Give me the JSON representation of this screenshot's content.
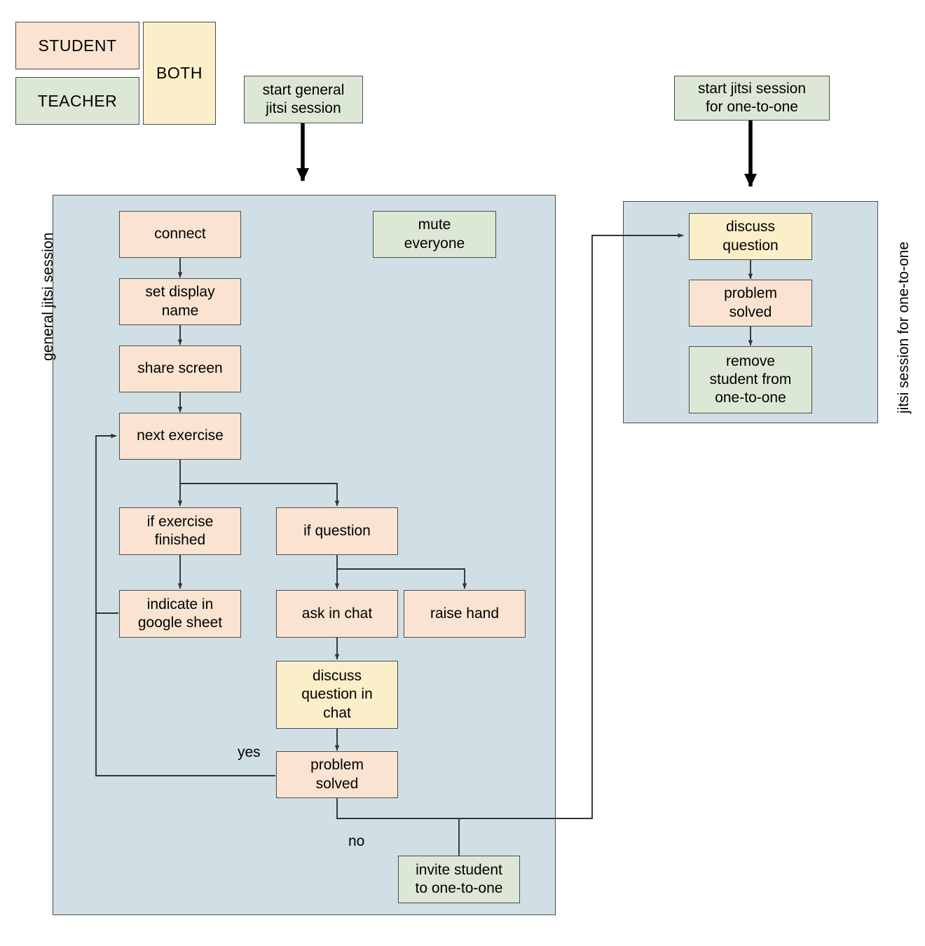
{
  "legend": {
    "items": [
      {
        "label": "STUDENT",
        "role": "student",
        "color": "#fae3d0"
      },
      {
        "label": "TEACHER",
        "role": "teacher",
        "color": "#dce8d5"
      },
      {
        "label": "BOTH",
        "role": "both",
        "color": "#fbefc9"
      }
    ]
  },
  "colors": {
    "student": "#fae3d0",
    "teacher": "#dce8d5",
    "both": "#fbefc9",
    "container": "#d0dfe5",
    "stroke": "#4d4d4d",
    "text": "#000000",
    "background": "#ffffff"
  },
  "containers": [
    {
      "id": "general",
      "label": "general jitsi session"
    },
    {
      "id": "oneToOne",
      "label": "jitsi session for one-to-one"
    }
  ],
  "start_nodes": [
    {
      "id": "start-general",
      "label": "start general\njitsi session",
      "role": "teacher"
    },
    {
      "id": "start-one-to-one",
      "label": "start jitsi session\nfor one-to-one",
      "role": "teacher"
    }
  ],
  "general_session_nodes": [
    {
      "id": "connect",
      "label": "connect",
      "role": "student"
    },
    {
      "id": "mute-everyone",
      "label": "mute\neveryone",
      "role": "teacher"
    },
    {
      "id": "set-display-name",
      "label": "set display\nname",
      "role": "student"
    },
    {
      "id": "share-screen",
      "label": "share screen",
      "role": "student"
    },
    {
      "id": "next-exercise",
      "label": "next exercise",
      "role": "student"
    },
    {
      "id": "if-exercise-finished",
      "label": "if exercise\nfinished",
      "role": "student"
    },
    {
      "id": "if-question",
      "label": "if question",
      "role": "student"
    },
    {
      "id": "indicate-in-google-sheet",
      "label": "indicate in\ngoogle sheet",
      "role": "student"
    },
    {
      "id": "ask-in-chat",
      "label": "ask in chat",
      "role": "student"
    },
    {
      "id": "raise-hand",
      "label": "raise hand",
      "role": "student"
    },
    {
      "id": "discuss-question-in-chat",
      "label": "discuss\nquestion in\nchat",
      "role": "both"
    },
    {
      "id": "problem-solved",
      "label": "problem\nsolved",
      "role": "student"
    },
    {
      "id": "invite-student-to-one-to-one",
      "label": "invite student\nto one-to-one",
      "role": "teacher"
    }
  ],
  "one_to_one_nodes": [
    {
      "id": "discuss-question",
      "label": "discuss\nquestion",
      "role": "both"
    },
    {
      "id": "problem-solved-oto",
      "label": "problem\nsolved",
      "role": "student"
    },
    {
      "id": "remove-student-from-one-to-one",
      "label": "remove\nstudent from\none-to-one",
      "role": "teacher"
    }
  ],
  "edge_labels": [
    {
      "id": "yes",
      "text": "yes"
    },
    {
      "id": "no",
      "text": "no"
    }
  ]
}
